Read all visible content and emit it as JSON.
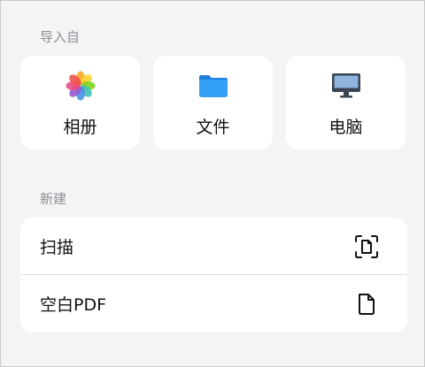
{
  "sections": {
    "import_label": "导入自",
    "new_label": "新建"
  },
  "import_sources": [
    {
      "label": "相册",
      "icon": "photos-icon"
    },
    {
      "label": "文件",
      "icon": "folder-icon"
    },
    {
      "label": "电脑",
      "icon": "computer-monitor-icon"
    }
  ],
  "new_items": [
    {
      "label": "扫描",
      "icon": "scan-document-icon"
    },
    {
      "label": "空白PDF",
      "icon": "blank-document-icon"
    }
  ],
  "colors": {
    "background": "#f4f4f6",
    "card": "#ffffff",
    "folder_blue": "#2f8fe8",
    "monitor_dark": "#3a4452",
    "secondary_text": "#8e8e93"
  }
}
